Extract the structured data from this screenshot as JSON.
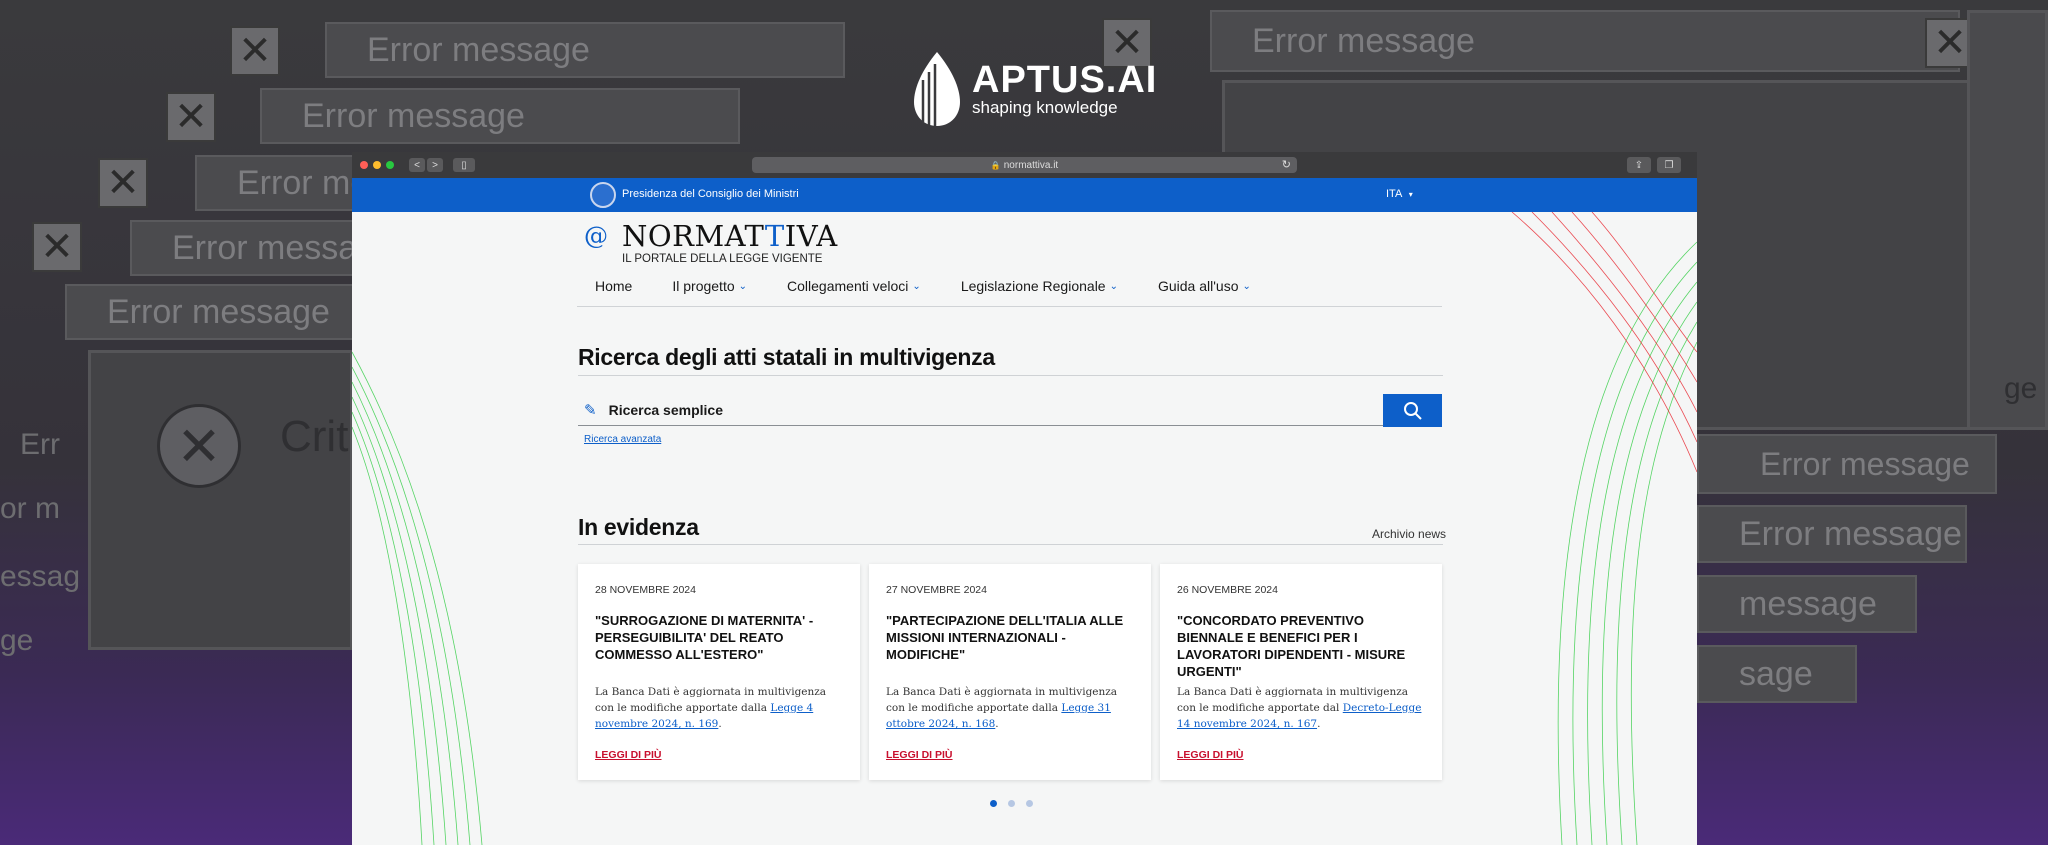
{
  "background": {
    "error_label": "Error message",
    "critical_fragment": "Crit",
    "fragments": [
      "Err",
      "or m",
      "essag",
      "ge",
      "ge",
      "message",
      "sage"
    ]
  },
  "logo": {
    "title": "APTUS.AI",
    "subtitle": "shaping knowledge"
  },
  "browser": {
    "url": "normattiva.it",
    "back": "<",
    "forward": ">"
  },
  "site": {
    "gov_label": "Presidenza del Consiglio dei Ministri",
    "language": "ITA",
    "brand_prefix": "NORMAT",
    "brand_accent": "T",
    "brand_suffix": "IVA",
    "brand_subtitle": "IL PORTALE DELLA LEGGE VIGENTE",
    "menu": [
      {
        "label": "Home",
        "has_dropdown": false
      },
      {
        "label": "Il progetto",
        "has_dropdown": true
      },
      {
        "label": "Collegamenti veloci",
        "has_dropdown": true
      },
      {
        "label": "Legislazione Regionale",
        "has_dropdown": true
      },
      {
        "label": "Guida all'uso",
        "has_dropdown": true
      }
    ],
    "search_heading": "Ricerca degli atti statali in multivigenza",
    "search_placeholder": "Ricerca semplice",
    "advanced_link": "Ricerca avanzata",
    "news_heading": "In evidenza",
    "archive_link": "Archivio news",
    "cards": [
      {
        "date": "28 NOVEMBRE 2024",
        "title": "\"SURROGAZIONE DI MATERNITA' - PERSEGUIBILITA' DEL REATO COMMESSO ALL'ESTERO\"",
        "body_prefix": "La Banca Dati è aggiornata in multivigenza con le modifiche apportate dalla ",
        "link": "Legge 4 novembre 2024, n. 169",
        "body_suffix": ".",
        "more": "LEGGI DI PIÙ"
      },
      {
        "date": "27 NOVEMBRE 2024",
        "title": "\"PARTECIPAZIONE DELL'ITALIA ALLE MISSIONI INTERNAZIONALI - MODIFICHE\"",
        "body_prefix": "La Banca Dati è aggiornata in multivigenza con le modifiche apportate dalla ",
        "link": "Legge 31 ottobre 2024, n. 168",
        "body_suffix": ".",
        "more": "LEGGI DI PIÙ"
      },
      {
        "date": "26 NOVEMBRE 2024",
        "title": "\"CONCORDATO PREVENTIVO BIENNALE E BENEFICI PER I LAVORATORI DIPENDENTI - MISURE URGENTI\"",
        "body_prefix": "La Banca Dati è aggiornata in multivigenza con le modifiche apportate dal ",
        "link": "Decreto-Legge 14 novembre 2024, n. 167",
        "body_suffix": ".",
        "more": "LEGGI DI PIÙ"
      }
    ],
    "carousel_active": 1,
    "carousel_total": 3
  },
  "colors": {
    "primary": "#0d5fc9",
    "link_red": "#c8102e",
    "background_purple": "#4a2a78"
  },
  "icons": [
    "search-icon",
    "pencil-icon",
    "chevron-down-icon",
    "close-icon",
    "lock-icon",
    "reload-icon",
    "share-icon",
    "tabs-icon",
    "sidebar-icon"
  ]
}
